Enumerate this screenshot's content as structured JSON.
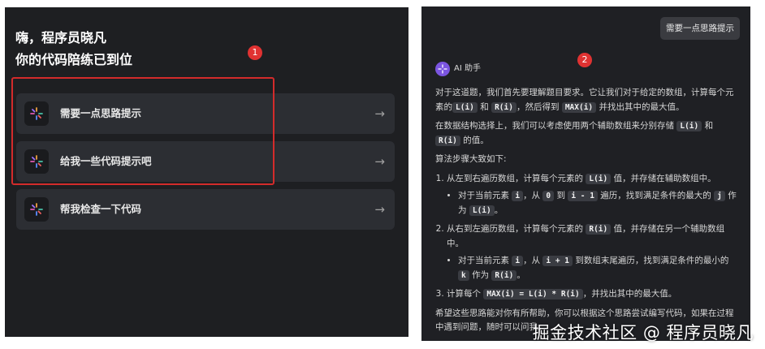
{
  "left": {
    "greeting_line1": "嗨，程序员晓凡",
    "greeting_line2": "你的代码陪练已到位",
    "marker": "1",
    "options": [
      {
        "label": "需要一点思路提示",
        "arrow": "→"
      },
      {
        "label": "给我一些代码提示吧",
        "arrow": "→"
      },
      {
        "label": "帮我检查一下代码",
        "arrow": "→"
      }
    ]
  },
  "right": {
    "user_message": "需要一点思路提示",
    "marker": "2",
    "assistant_name": "AI 助手",
    "p1_a": "对于这道题，我们首先要理解题目要求。它让我们对于给定的数组，计算每个元素的",
    "p1_code1": "L(i)",
    "p1_b": "和",
    "p1_code2": "R(i)",
    "p1_c": "，然后得到",
    "p1_code3": "MAX(i)",
    "p1_d": "并找出其中的最大值。",
    "p2_a": "在数据结构选择上，我们可以考虑使用两个辅助数组来分别存储",
    "p2_code1": "L(i)",
    "p2_b": "和",
    "p2_code2": "R(i)",
    "p2_c": "的值。",
    "p3": "算法步骤大致如下:",
    "s1_a": "从左到右遍历数组，计算每个元素的",
    "s1_code": "L(i)",
    "s1_b": "值，并存储在辅助数组中。",
    "s1_sub_a": "对于当前元素",
    "s1_sub_code1": "i",
    "s1_sub_b": "，从",
    "s1_sub_code2": "0",
    "s1_sub_c": "到",
    "s1_sub_code3": "i - 1",
    "s1_sub_d": "遍历，找到满足条件的最大的",
    "s1_sub_code4": "j",
    "s1_sub_e": "作为",
    "s1_sub_code5": "L(i)",
    "s1_sub_f": "。",
    "s2_a": "从右到左遍历数组，计算每个元素的",
    "s2_code": "R(i)",
    "s2_b": "值，并存储在另一个辅助数组中。",
    "s2_sub_a": "对于当前元素",
    "s2_sub_code1": "i",
    "s2_sub_b": "，从",
    "s2_sub_code2": "i + 1",
    "s2_sub_c": "到数组末尾遍历，找到满足条件的最小的",
    "s2_sub_code3": "k",
    "s2_sub_d": "作为",
    "s2_sub_code4": "R(i)",
    "s2_sub_e": "。",
    "s3_a": "计算每个",
    "s3_code": "MAX(i) = L(i) * R(i)",
    "s3_b": "，并找出其中的最大值。",
    "p4_line1": "希望这些思路能对你有所帮助，你可以根据这个思路尝试编写代码，如果在过程",
    "p4_line2": "中遇到问题，随时可以问我。"
  },
  "watermark": "掘金技术社区 @ 程序员晓凡",
  "colors": {
    "panel_bg": "#1e1f22",
    "option_bg": "#2c2e33",
    "highlight": "#d32b2b",
    "marker": "#e03232",
    "ai_avatar": "#7b55e0"
  }
}
